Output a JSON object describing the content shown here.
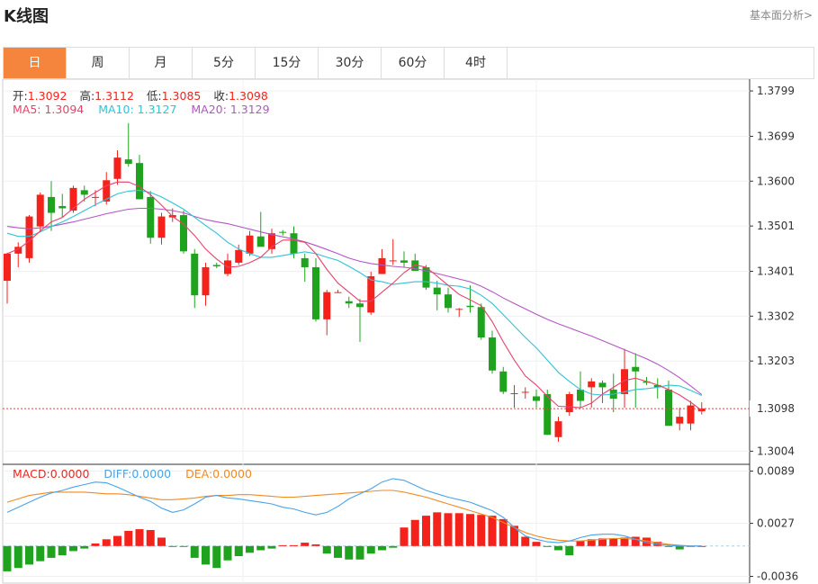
{
  "header": {
    "title": "K线图",
    "link": "基本面分析>"
  },
  "tabs": [
    {
      "label": "日",
      "active": true
    },
    {
      "label": "周",
      "active": false
    },
    {
      "label": "月",
      "active": false
    },
    {
      "label": "5分",
      "active": false
    },
    {
      "label": "15分",
      "active": false
    },
    {
      "label": "30分",
      "active": false
    },
    {
      "label": "60分",
      "active": false
    },
    {
      "label": "4时",
      "active": false
    }
  ],
  "ohlc_info": {
    "open_label": "开:",
    "open": "1.3092",
    "high_label": "高:",
    "high": "1.3112",
    "low_label": "低:",
    "low": "1.3085",
    "close_label": "收:",
    "close": "1.3098"
  },
  "ma_info": {
    "ma5_label": "MA5: ",
    "ma5": "1.3094",
    "ma10_label": "MA10: ",
    "ma10": "1.3127",
    "ma20_label": "MA20: ",
    "ma20": "1.3129"
  },
  "macd_info": {
    "macd_label": "MACD:",
    "macd": "0.0000",
    "diff_label": "DIFF:",
    "diff": "0.0000",
    "dea_label": "DEA:",
    "dea": "0.0000"
  },
  "colors": {
    "up": "#f5221b",
    "down": "#1fa31f",
    "ma5": "#e8416b",
    "ma10": "#30c3d6",
    "ma20": "#b455c6",
    "diff": "#4aa3e8",
    "dea": "#f08a24",
    "active_tab": "#f5843c",
    "price_line": "#e64340"
  },
  "chart_data": {
    "type": "candlestick",
    "price_axis": {
      "ticks": [
        "1.3799",
        "1.3699",
        "1.3600",
        "1.3501",
        "1.3401",
        "1.3302",
        "1.3203",
        "1.3004"
      ],
      "ylim": [
        1.2975,
        1.3825
      ]
    },
    "current_price_label": "1.3098",
    "macd_axis": {
      "ticks": [
        "0.0089",
        "0.0027",
        "-0.0036"
      ],
      "ylim": [
        -0.0044,
        0.0097
      ]
    },
    "candles": [
      [
        1.338,
        1.3442,
        1.333,
        1.344
      ],
      [
        1.344,
        1.3465,
        1.341,
        1.3455
      ],
      [
        1.343,
        1.3525,
        1.342,
        1.3522
      ],
      [
        1.35,
        1.3575,
        1.349,
        1.357
      ],
      [
        1.3565,
        1.36,
        1.349,
        1.353
      ],
      [
        1.3545,
        1.3572,
        1.352,
        1.354
      ],
      [
        1.3535,
        1.359,
        1.353,
        1.3585
      ],
      [
        1.358,
        1.359,
        1.3555,
        1.357
      ],
      [
        1.3565,
        1.358,
        1.3545,
        1.3565
      ],
      [
        1.3555,
        1.362,
        1.3548,
        1.3602
      ],
      [
        1.3605,
        1.3668,
        1.3592,
        1.3652
      ],
      [
        1.3648,
        1.3728,
        1.3632,
        1.3638
      ],
      [
        1.364,
        1.3658,
        1.356,
        1.356
      ],
      [
        1.3565,
        1.3578,
        1.3462,
        1.3475
      ],
      [
        1.3475,
        1.353,
        1.346,
        1.3522
      ],
      [
        1.352,
        1.354,
        1.351,
        1.3525
      ],
      [
        1.3525,
        1.3535,
        1.344,
        1.3445
      ],
      [
        1.344,
        1.345,
        1.332,
        1.3348
      ],
      [
        1.3348,
        1.342,
        1.3325,
        1.341
      ],
      [
        1.3415,
        1.342,
        1.3408,
        1.3412
      ],
      [
        1.3395,
        1.344,
        1.339,
        1.3425
      ],
      [
        1.342,
        1.346,
        1.3415,
        1.3448
      ],
      [
        1.344,
        1.349,
        1.3435,
        1.348
      ],
      [
        1.3478,
        1.3532,
        1.3465,
        1.3455
      ],
      [
        1.345,
        1.3495,
        1.344,
        1.3485
      ],
      [
        1.3488,
        1.3492,
        1.348,
        1.3486
      ],
      [
        1.3485,
        1.35,
        1.343,
        1.344
      ],
      [
        1.343,
        1.344,
        1.3378,
        1.341
      ],
      [
        1.341,
        1.343,
        1.329,
        1.3295
      ],
      [
        1.3295,
        1.336,
        1.326,
        1.3355
      ],
      [
        1.3355,
        1.336,
        1.3353,
        1.3355
      ],
      [
        1.3335,
        1.3345,
        1.332,
        1.333
      ],
      [
        1.333,
        1.334,
        1.3245,
        1.3322
      ],
      [
        1.331,
        1.34,
        1.3305,
        1.339
      ],
      [
        1.3395,
        1.345,
        1.3395,
        1.343
      ],
      [
        1.3425,
        1.3472,
        1.3415,
        1.3425
      ],
      [
        1.3425,
        1.3445,
        1.341,
        1.342
      ],
      [
        1.3425,
        1.344,
        1.341,
        1.3402
      ],
      [
        1.341,
        1.3415,
        1.336,
        1.3365
      ],
      [
        1.3365,
        1.338,
        1.3315,
        1.335
      ],
      [
        1.335,
        1.3365,
        1.331,
        1.332
      ],
      [
        1.3318,
        1.332,
        1.33,
        1.3318
      ],
      [
        1.3325,
        1.337,
        1.331,
        1.3322
      ],
      [
        1.3322,
        1.333,
        1.325,
        1.3255
      ],
      [
        1.3255,
        1.327,
        1.3175,
        1.3182
      ],
      [
        1.318,
        1.319,
        1.313,
        1.3135
      ],
      [
        1.313,
        1.315,
        1.31,
        1.3132
      ],
      [
        1.3135,
        1.3145,
        1.312,
        1.3135
      ],
      [
        1.3125,
        1.314,
        1.31,
        1.3115
      ],
      [
        1.313,
        1.314,
        1.304,
        1.304
      ],
      [
        1.3035,
        1.308,
        1.3025,
        1.307
      ],
      [
        1.309,
        1.3135,
        1.3082,
        1.313
      ],
      [
        1.314,
        1.318,
        1.31,
        1.3115
      ],
      [
        1.3145,
        1.3165,
        1.31,
        1.3158
      ],
      [
        1.3155,
        1.316,
        1.311,
        1.3145
      ],
      [
        1.314,
        1.3175,
        1.309,
        1.312
      ],
      [
        1.313,
        1.323,
        1.31,
        1.3185
      ],
      [
        1.319,
        1.322,
        1.31,
        1.318
      ],
      [
        1.3158,
        1.3168,
        1.315,
        1.3155
      ],
      [
        1.315,
        1.3165,
        1.312,
        1.3145
      ],
      [
        1.314,
        1.316,
        1.306,
        1.306
      ],
      [
        1.3065,
        1.31,
        1.305,
        1.308
      ],
      [
        1.3065,
        1.3115,
        1.305,
        1.3105
      ],
      [
        1.3092,
        1.3112,
        1.3085,
        1.3098
      ]
    ],
    "ma5": [
      1.344,
      1.345,
      1.3468,
      1.349,
      1.351,
      1.352,
      1.354,
      1.356,
      1.3575,
      1.359,
      1.3598,
      1.3598,
      1.3588,
      1.357,
      1.3547,
      1.3522,
      1.3505,
      1.348,
      1.345,
      1.3428,
      1.341,
      1.3412,
      1.342,
      1.3432,
      1.3455,
      1.347,
      1.347,
      1.3465,
      1.344,
      1.3405,
      1.3375,
      1.3355,
      1.3335,
      1.3335,
      1.3355,
      1.3375,
      1.3398,
      1.3415,
      1.341,
      1.339,
      1.337,
      1.335,
      1.3338,
      1.3325,
      1.329,
      1.3245,
      1.3205,
      1.317,
      1.315,
      1.3125,
      1.3103,
      1.3102,
      1.31,
      1.311,
      1.313,
      1.3145,
      1.316,
      1.3165,
      1.3158,
      1.315,
      1.314,
      1.3128,
      1.3112,
      1.3094
    ],
    "ma10": [
      1.3485,
      1.3478,
      1.3478,
      1.3488,
      1.35,
      1.351,
      1.3522,
      1.3535,
      1.3548,
      1.356,
      1.3572,
      1.3578,
      1.358,
      1.3575,
      1.3565,
      1.3552,
      1.3538,
      1.352,
      1.3502,
      1.3485,
      1.3465,
      1.345,
      1.344,
      1.3432,
      1.3432,
      1.3436,
      1.344,
      1.3444,
      1.344,
      1.3432,
      1.3425,
      1.3412,
      1.3398,
      1.3382,
      1.3378,
      1.3372,
      1.3375,
      1.3378,
      1.3378,
      1.3375,
      1.337,
      1.3368,
      1.3362,
      1.3348,
      1.333,
      1.3305,
      1.328,
      1.3255,
      1.3232,
      1.3205,
      1.3178,
      1.3158,
      1.314,
      1.313,
      1.3128,
      1.313,
      1.3135,
      1.314,
      1.3142,
      1.3145,
      1.315,
      1.3148,
      1.3138,
      1.3127
    ],
    "ma20": [
      1.35,
      1.3497,
      1.3495,
      1.3497,
      1.35,
      1.3505,
      1.351,
      1.3516,
      1.3522,
      1.3528,
      1.3533,
      1.3538,
      1.354,
      1.354,
      1.3538,
      1.3535,
      1.353,
      1.3522,
      1.3515,
      1.351,
      1.3506,
      1.35,
      1.3494,
      1.3488,
      1.3482,
      1.3477,
      1.3472,
      1.3466,
      1.3458,
      1.3449,
      1.344,
      1.343,
      1.3423,
      1.3418,
      1.3415,
      1.3412,
      1.341,
      1.3407,
      1.3402,
      1.3396,
      1.339,
      1.3384,
      1.3378,
      1.3368,
      1.3356,
      1.3342,
      1.333,
      1.3318,
      1.3306,
      1.3295,
      1.3285,
      1.3276,
      1.3267,
      1.3258,
      1.3248,
      1.3238,
      1.3228,
      1.3218,
      1.3208,
      1.3196,
      1.3182,
      1.3166,
      1.3148,
      1.3129
    ],
    "macd_bars": [
      -0.003,
      -0.0026,
      -0.0022,
      -0.0018,
      -0.0014,
      -0.0011,
      -0.0006,
      -0.0003,
      0.0003,
      0.0008,
      0.0012,
      0.0018,
      0.002,
      0.0019,
      0.001,
      -0.0001,
      -0.0001,
      -0.0014,
      -0.0022,
      -0.0026,
      -0.0017,
      -0.0012,
      -0.0008,
      -0.0005,
      -0.0003,
      0.0001,
      0.0001,
      0.0004,
      0.0002,
      -0.0009,
      -0.0014,
      -0.0016,
      -0.0016,
      -0.0009,
      -0.0005,
      -0.0002,
      0.0022,
      0.0031,
      0.0036,
      0.004,
      0.0039,
      0.0039,
      0.0038,
      0.0037,
      0.0036,
      0.0032,
      0.0024,
      0.0011,
      0.0005,
      -0.0001,
      -0.0005,
      -0.0011,
      0.0006,
      0.0008,
      0.0009,
      0.0009,
      0.001,
      0.0011,
      0.001,
      0.0005,
      -0.0001,
      -0.0004,
      -0.0001,
      0.0
    ],
    "diff": [
      0.004,
      0.0046,
      0.0052,
      0.0058,
      0.0063,
      0.0066,
      0.007,
      0.0073,
      0.0076,
      0.0075,
      0.007,
      0.0064,
      0.0058,
      0.0053,
      0.0045,
      0.004,
      0.0043,
      0.005,
      0.0058,
      0.006,
      0.0057,
      0.0056,
      0.0054,
      0.0052,
      0.005,
      0.0046,
      0.0044,
      0.004,
      0.0037,
      0.004,
      0.0047,
      0.0056,
      0.0062,
      0.0068,
      0.0076,
      0.008,
      0.0078,
      0.0072,
      0.0066,
      0.0062,
      0.0058,
      0.0055,
      0.0052,
      0.0047,
      0.0042,
      0.0034,
      0.0022,
      0.0012,
      0.0008,
      0.0005,
      0.0004,
      0.0006,
      0.001,
      0.0013,
      0.0014,
      0.0014,
      0.0012,
      0.0008,
      0.0004,
      0.0002,
      0.0001,
      0.0,
      0.0,
      0.0
    ],
    "dea": [
      0.0052,
      0.0056,
      0.006,
      0.0062,
      0.0064,
      0.0064,
      0.0064,
      0.0064,
      0.0063,
      0.0062,
      0.0062,
      0.0061,
      0.0059,
      0.0057,
      0.0055,
      0.0055,
      0.0056,
      0.0057,
      0.0059,
      0.006,
      0.006,
      0.0061,
      0.0061,
      0.006,
      0.0059,
      0.0058,
      0.0058,
      0.0059,
      0.006,
      0.0061,
      0.0062,
      0.0063,
      0.0064,
      0.0065,
      0.0066,
      0.0066,
      0.0064,
      0.0061,
      0.0058,
      0.0054,
      0.005,
      0.0046,
      0.0042,
      0.0038,
      0.0034,
      0.0028,
      0.0022,
      0.0016,
      0.0012,
      0.0009,
      0.0007,
      0.0006,
      0.0006,
      0.0007,
      0.0008,
      0.0009,
      0.0009,
      0.0008,
      0.0006,
      0.0004,
      0.0002,
      0.0001,
      0.0,
      0.0
    ]
  }
}
